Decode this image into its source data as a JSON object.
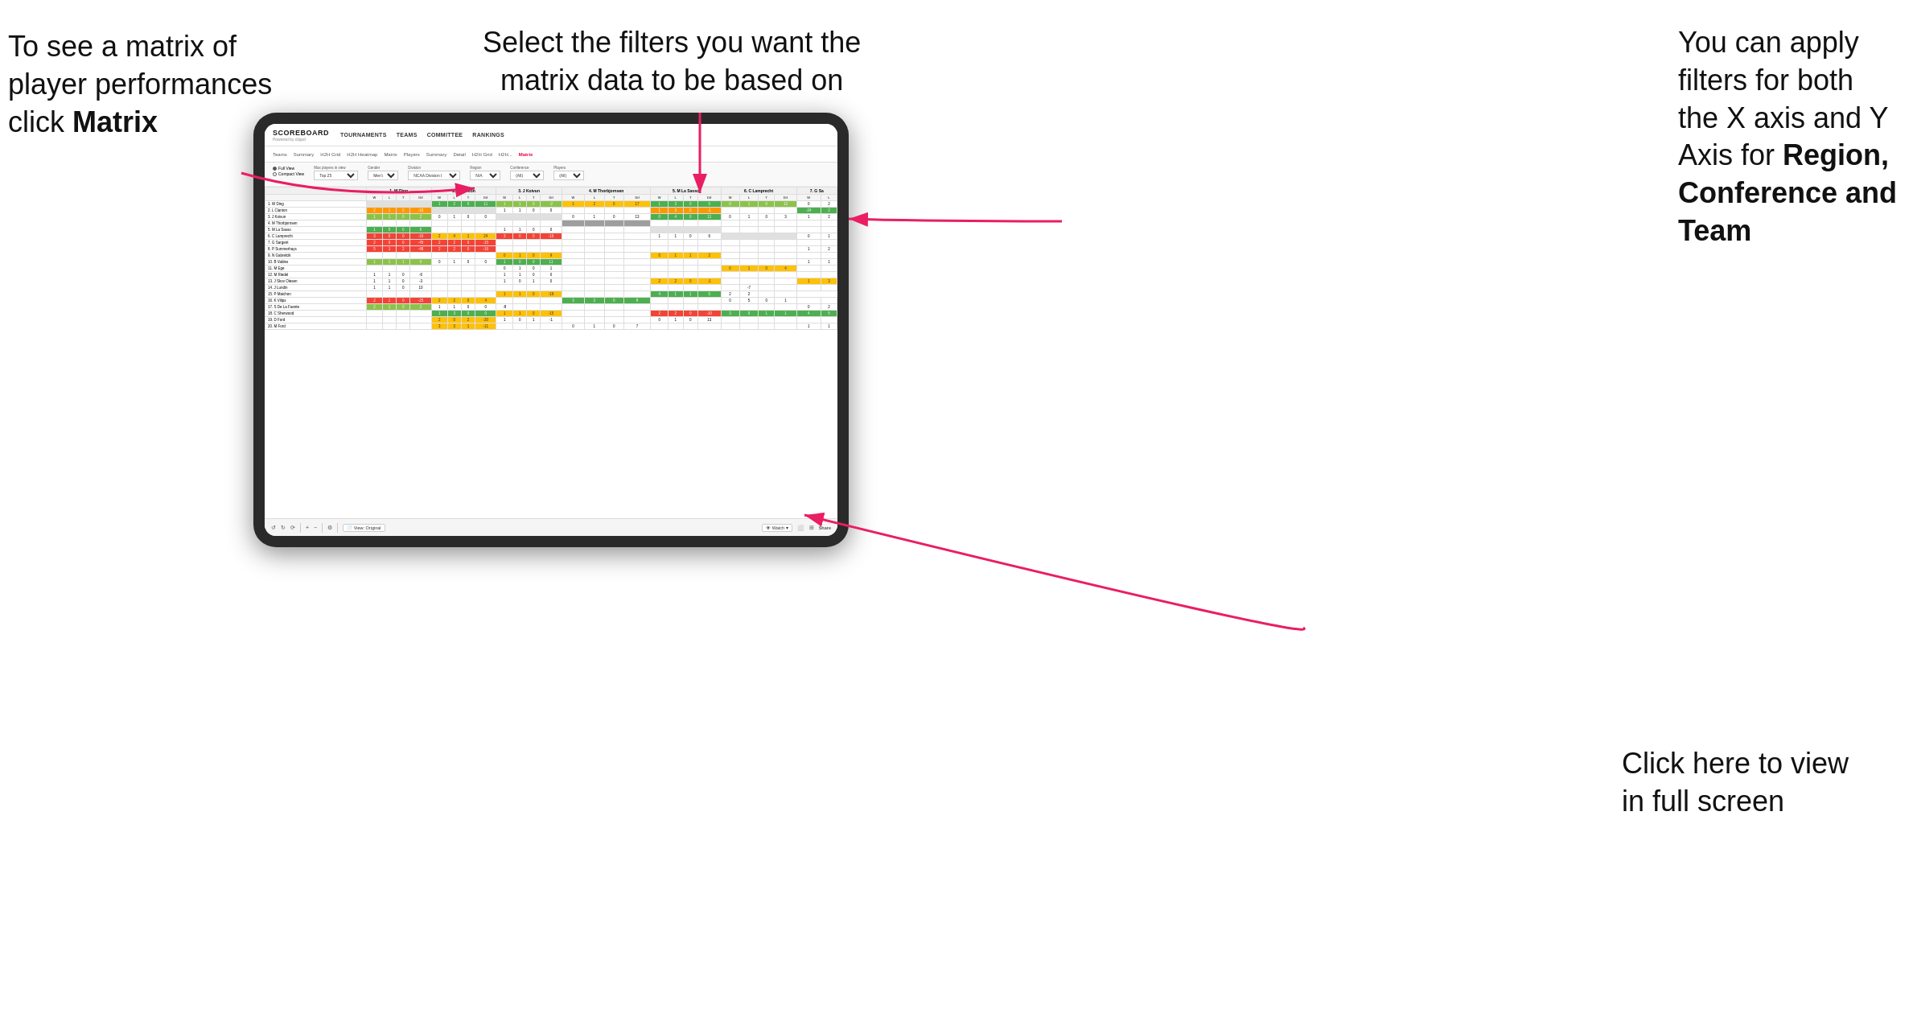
{
  "annotations": {
    "top_left": {
      "line1": "To see a matrix of",
      "line2": "player performances",
      "line3_prefix": "click ",
      "line3_bold": "Matrix"
    },
    "top_center": {
      "line1": "Select the filters you want the",
      "line2": "matrix data to be based on"
    },
    "top_right": {
      "line1": "You  can apply",
      "line2": "filters for both",
      "line3": "the X axis and Y",
      "line4_prefix": "Axis for ",
      "line4_bold": "Region,",
      "line5_bold": "Conference and",
      "line6_bold": "Team"
    },
    "bottom_right": {
      "line1": "Click here to view",
      "line2": "in full screen"
    }
  },
  "app": {
    "logo_title": "SCOREBOARD",
    "logo_powered": "Powered by clippd",
    "nav_items": [
      "TOURNAMENTS",
      "TEAMS",
      "COMMITTEE",
      "RANKINGS"
    ],
    "sub_nav": [
      "Teams",
      "Summary",
      "H2H Grid",
      "H2H Heatmap",
      "Matrix",
      "Players",
      "Summary",
      "Detail",
      "H2H Grid",
      "H2H...",
      "Matrix"
    ],
    "active_tab": "Matrix"
  },
  "filters": {
    "view_full": "Full View",
    "view_compact": "Compact View",
    "max_players_label": "Max players in view",
    "max_players_value": "Top 25",
    "gender_label": "Gender",
    "gender_value": "Men's",
    "division_label": "Division",
    "division_value": "NCAA Division I",
    "region_label": "Region",
    "region_value": "N/A",
    "conference_label": "Conference",
    "conference_value": "(All)",
    "players_label": "Players",
    "players_value": "(All)"
  },
  "matrix": {
    "column_headers": [
      "1. W Ding",
      "2. L Clanton",
      "3. J Koivun",
      "4. M Thorbjornsen",
      "5. M La Sasso",
      "6. C Lamprecht",
      "7. G Sa"
    ],
    "sub_headers": [
      "W",
      "L",
      "T",
      "Dif"
    ],
    "rows": [
      {
        "name": "1. W Ding",
        "vals": [
          "",
          "",
          "",
          "",
          "1",
          "2",
          "0",
          "11",
          "1",
          "1",
          "0",
          "-2",
          "1",
          "2",
          "0",
          "17",
          "1",
          "3",
          "0",
          "0",
          "0",
          "1",
          "0",
          "13",
          "0",
          "2"
        ]
      },
      {
        "name": "2. L Clanton",
        "vals": [
          "2",
          "1",
          "0",
          "-16",
          "",
          "",
          "",
          "",
          "1",
          "1",
          "0",
          "0",
          "",
          "",
          "",
          "",
          "1",
          "3",
          "0",
          "-1",
          "",
          "",
          "",
          "",
          "1",
          "0",
          "0",
          "-24",
          "2",
          "2"
        ]
      },
      {
        "name": "3. J Koivun",
        "vals": [
          "1",
          "1",
          "0",
          "2",
          "0",
          "1",
          "0",
          "0",
          "",
          "",
          "",
          "",
          "",
          "0",
          "1",
          "0",
          "13",
          "0",
          "4",
          "0",
          "11",
          "0",
          "1",
          "0",
          "3",
          "1",
          "2"
        ]
      },
      {
        "name": "4. M Thorbjornsen",
        "vals": [
          "",
          "",
          "",
          "",
          "",
          "",
          "",
          "",
          "",
          "",
          "",
          "",
          "",
          "",
          "",
          "",
          "",
          "",
          "",
          "",
          "",
          "",
          "",
          "",
          "",
          ""
        ]
      },
      {
        "name": "5. M La Sasso",
        "vals": [
          "1",
          "5",
          "0",
          "0",
          "",
          "",
          "",
          "",
          "1",
          "1",
          "0",
          "0",
          "",
          "",
          "",
          "",
          "1",
          "0",
          "0",
          "",
          "",
          "",
          "",
          "",
          "",
          ""
        ]
      },
      {
        "name": "6. C Lamprecht",
        "vals": [
          "3",
          "0",
          "0",
          "-16",
          "2",
          "4",
          "1",
          "24",
          "3",
          "0",
          "5",
          "-16",
          "",
          "",
          "",
          "",
          "1",
          "1",
          "0",
          "6",
          "",
          "",
          "",
          "",
          "0",
          "1"
        ]
      },
      {
        "name": "7. G Sargent",
        "vals": [
          "2",
          "0",
          "0",
          "-45",
          "2",
          "2",
          "0",
          "-15",
          "",
          "",
          "",
          "",
          "",
          "",
          "",
          "",
          "",
          "",
          "",
          "",
          "",
          "",
          "",
          "",
          "",
          ""
        ]
      },
      {
        "name": "8. P Summerhays",
        "vals": [
          "5",
          "1",
          "2",
          "-48",
          "2",
          "2",
          "0",
          "-16",
          "",
          "",
          "",
          "",
          "",
          "",
          "",
          "",
          "",
          "",
          "",
          "",
          "",
          "",
          "",
          "",
          "1",
          "2"
        ]
      },
      {
        "name": "9. N Gabrelcik",
        "vals": [
          "",
          "",
          "",
          "",
          "",
          "",
          "",
          "",
          "0",
          "1",
          "0",
          "9",
          "",
          "",
          "",
          "",
          "0",
          "1",
          "1",
          "2",
          "",
          "",
          "",
          "",
          "",
          ""
        ]
      },
      {
        "name": "10. B Valdes",
        "vals": [
          "1",
          "1",
          "1",
          "0",
          "0",
          "1",
          "0",
          "0",
          "1",
          "0",
          "0",
          "11",
          "",
          "",
          "",
          "",
          "",
          "",
          "",
          "",
          "",
          "",
          "",
          "",
          "1",
          "1"
        ]
      },
      {
        "name": "11. M Ege",
        "vals": [
          "",
          "",
          "",
          "",
          "",
          "",
          "",
          "",
          "0",
          "1",
          "0",
          "1",
          "",
          "",
          "",
          "",
          "",
          "",
          "",
          "",
          "0",
          "1",
          "0",
          "4",
          "",
          ""
        ]
      },
      {
        "name": "12. M Riedel",
        "vals": [
          "1",
          "1",
          "0",
          "-6",
          "",
          "",
          "",
          "",
          "1",
          "1",
          "0",
          "0",
          "",
          "",
          "",
          "",
          "",
          "",
          "",
          "",
          "",
          "",
          "",
          "",
          "",
          ""
        ]
      },
      {
        "name": "13. J Skov Olesen",
        "vals": [
          "1",
          "1",
          "0",
          "-3",
          "",
          "",
          "",
          "",
          "1",
          "0",
          "1",
          "0",
          "",
          "",
          "",
          "",
          "2",
          "2",
          "0",
          "-1",
          "",
          "",
          "",
          "",
          "1",
          "3"
        ]
      },
      {
        "name": "14. J Lundin",
        "vals": [
          "1",
          "1",
          "0",
          "10",
          "",
          "",
          "",
          "",
          "",
          "",
          "",
          "",
          "",
          "",
          "",
          "",
          "",
          "",
          "",
          "",
          "",
          "",
          "",
          "-7",
          "",
          ""
        ]
      },
      {
        "name": "15. P Maichon",
        "vals": [
          "",
          "",
          "",
          "",
          "",
          "",
          "",
          "",
          "1",
          "1",
          "0",
          "-19",
          "",
          "",
          "",
          "",
          "4",
          "1",
          "1",
          "0",
          "-7",
          "2",
          "2"
        ]
      },
      {
        "name": "16. K Vilips",
        "vals": [
          "2",
          "1",
          "0",
          "-25",
          "2",
          "2",
          "0",
          "4",
          "",
          "",
          "",
          "",
          "3",
          "3",
          "0",
          "8",
          "",
          "",
          "",
          "",
          "0",
          "5",
          "0",
          "1"
        ]
      },
      {
        "name": "17. S De La Fuente",
        "vals": [
          "2",
          "1",
          "0",
          "2",
          "1",
          "1",
          "0",
          "0",
          "-8",
          "",
          "",
          "",
          "",
          "",
          "",
          "",
          "",
          "",
          "",
          "",
          "",
          "",
          "",
          "",
          "0",
          "2"
        ]
      },
      {
        "name": "18. C Sherwood",
        "vals": [
          "",
          "",
          "",
          "",
          "1",
          "3",
          "0",
          "0",
          "1",
          "1",
          "0",
          "-15",
          "",
          "",
          "",
          "",
          "2",
          "2",
          "0",
          "-10",
          "3",
          "0",
          "1",
          "1",
          "4",
          "5"
        ]
      },
      {
        "name": "19. D Ford",
        "vals": [
          "",
          "",
          "",
          "",
          "2",
          "0",
          "2",
          "-20",
          "1",
          "0",
          "1",
          "-1",
          "",
          "",
          "",
          "",
          "0",
          "1",
          "0",
          "13",
          "",
          "",
          "",
          "",
          "",
          ""
        ]
      },
      {
        "name": "20. M Ford",
        "vals": [
          "",
          "",
          "",
          "",
          "3",
          "3",
          "1",
          "-11",
          "",
          "",
          "",
          "",
          "0",
          "1",
          "0",
          "7",
          "",
          "",
          "",
          "",
          "",
          "",
          "",
          "",
          "1",
          "1"
        ]
      }
    ]
  },
  "footer": {
    "view_label": "View: Original",
    "watch_label": "Watch ▾",
    "share_label": "Share"
  }
}
